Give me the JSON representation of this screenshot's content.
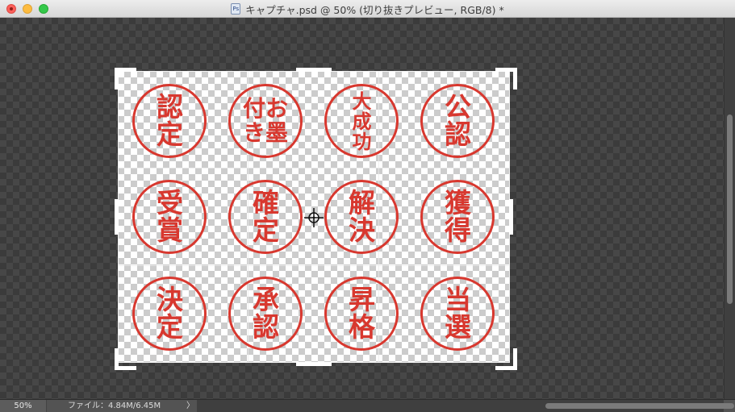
{
  "window": {
    "title": "キャプチャ.psd @ 50% (切り抜きプレビュー, RGB/8) *",
    "file_icon": "Ps"
  },
  "canvas": {
    "stamps": [
      {
        "lines": [
          "認",
          "定"
        ]
      },
      {
        "columns": [
          [
            "付",
            "き"
          ],
          [
            "お",
            "墨"
          ]
        ]
      },
      {
        "lines": [
          "大",
          "成",
          "功"
        ]
      },
      {
        "lines": [
          "公",
          "認"
        ]
      },
      {
        "lines": [
          "受",
          "賞"
        ]
      },
      {
        "lines": [
          "確",
          "定"
        ]
      },
      {
        "lines": [
          "解",
          "決"
        ]
      },
      {
        "lines": [
          "獲",
          "得"
        ]
      },
      {
        "lines": [
          "決",
          "定"
        ]
      },
      {
        "lines": [
          "承",
          "認"
        ]
      },
      {
        "lines": [
          "昇",
          "格"
        ]
      },
      {
        "lines": [
          "当",
          "選"
        ]
      }
    ]
  },
  "statusbar": {
    "zoom": "50%",
    "file_info": "ファイル：4.84M/6.45M",
    "arrow": "〉"
  },
  "colors": {
    "stamp_red": "#d8382f",
    "workspace": "#3b3b3b"
  }
}
